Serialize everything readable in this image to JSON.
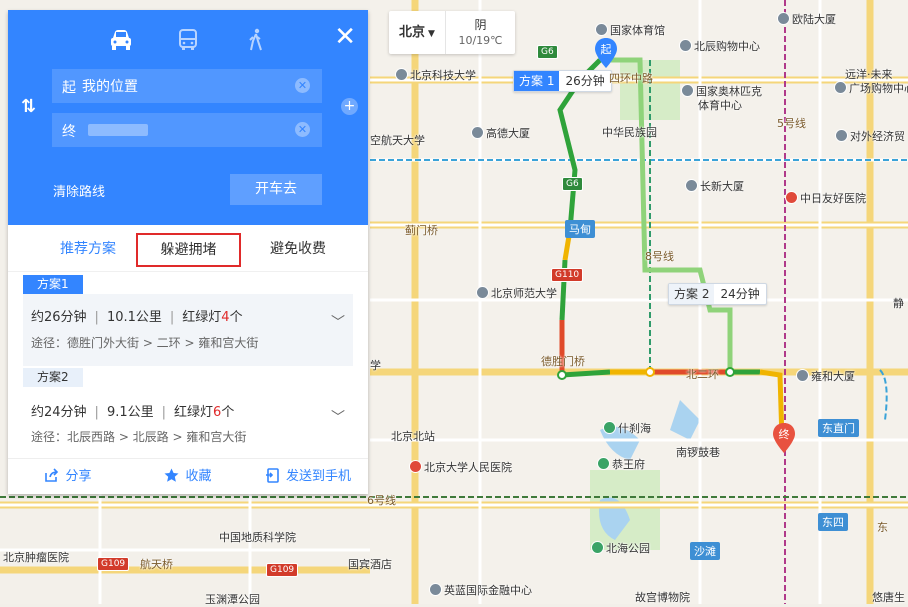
{
  "panel": {
    "modes": [
      "car-icon",
      "bus-icon",
      "walk-icon"
    ],
    "start_label": "起",
    "start_value": "我的位置",
    "end_label": "终",
    "end_value": "",
    "clear_route": "清除路线",
    "drive_button": "开车去",
    "tabs": [
      "推荐方案",
      "躲避拥堵",
      "避免收费"
    ],
    "plans": [
      {
        "name": "方案1",
        "time": "约26分钟",
        "distance": "10.1公里",
        "lights_prefix": "红绿灯",
        "lights": "4",
        "lights_suffix": "个",
        "route": "途径：德胜门外大街 > 二环 > 雍和宫大街"
      },
      {
        "name": "方案2",
        "time": "约24分钟",
        "distance": "9.1公里",
        "lights_prefix": "红绿灯",
        "lights": "6",
        "lights_suffix": "个",
        "route": "途径：北辰西路 > 北辰路 > 雍和宫大街"
      }
    ],
    "actions": {
      "share": "分享",
      "favorite": "收藏",
      "send": "发送到手机"
    }
  },
  "weather": {
    "city": "北京",
    "condition": "阴",
    "temp": "10/19℃"
  },
  "map": {
    "route_tags": [
      {
        "name": "方案 1",
        "time": "26分钟"
      },
      {
        "name": "方案 2",
        "time": "24分钟"
      }
    ],
    "markers": {
      "start": "起",
      "end": "终"
    },
    "labels": {
      "olympic_stadium": "国家体育馆",
      "beichen_mall": "北辰购物中心",
      "ouwen_building": "欧陆大厦",
      "bust": "北京科技大学",
      "west_ring": "四环中路",
      "yuanyang": "远洋·未来",
      "yuanyang2": "广场购物中心",
      "olympic_forest": "国家奥林匹克",
      "olympic_forest2": "体育中心",
      "gaode": "高德大厦",
      "zhonghua": "中华民族园",
      "trade_univ": "对外经济贸",
      "hangtian": "空航天大学",
      "changxin": "长新大厦",
      "zhongri": "中日友好医院",
      "jiandemen": "蓟门桥",
      "madian": "马甸",
      "bnu": "北京师范大学",
      "jing": "静",
      "deshengmen": "德胜门桥",
      "second_ring": "北二环",
      "yonghe": "雍和大厦",
      "shichahai": "什刹海",
      "xue": "学",
      "beijing_north": "北京北站",
      "nanluoguxiang": "南锣鼓巷",
      "dongzhimen": "东直门",
      "pku_hospital": "北京大学人民医院",
      "gongwangfu": "恭王府",
      "line6": "6号线",
      "line5": "5号线",
      "line8": "8号线",
      "dongsi": "东四",
      "dongshi": "东四",
      "geo": "中国地质科学院",
      "tumor": "北京肿瘤医院",
      "hangtianqiao": "航天桥",
      "guobin": "国宾酒店",
      "beihai": "北海公园",
      "shatan": "沙滩",
      "yinghao": "英蓝国际金融中心",
      "gugong": "故宫博物院",
      "yuyuantan": "玉渊潭公园",
      "youse": "悠唐生",
      "g6": "G6",
      "g110": "G110",
      "g109": "G109",
      "dongsi_shitiao": "东四",
      "dong": "东"
    }
  }
}
